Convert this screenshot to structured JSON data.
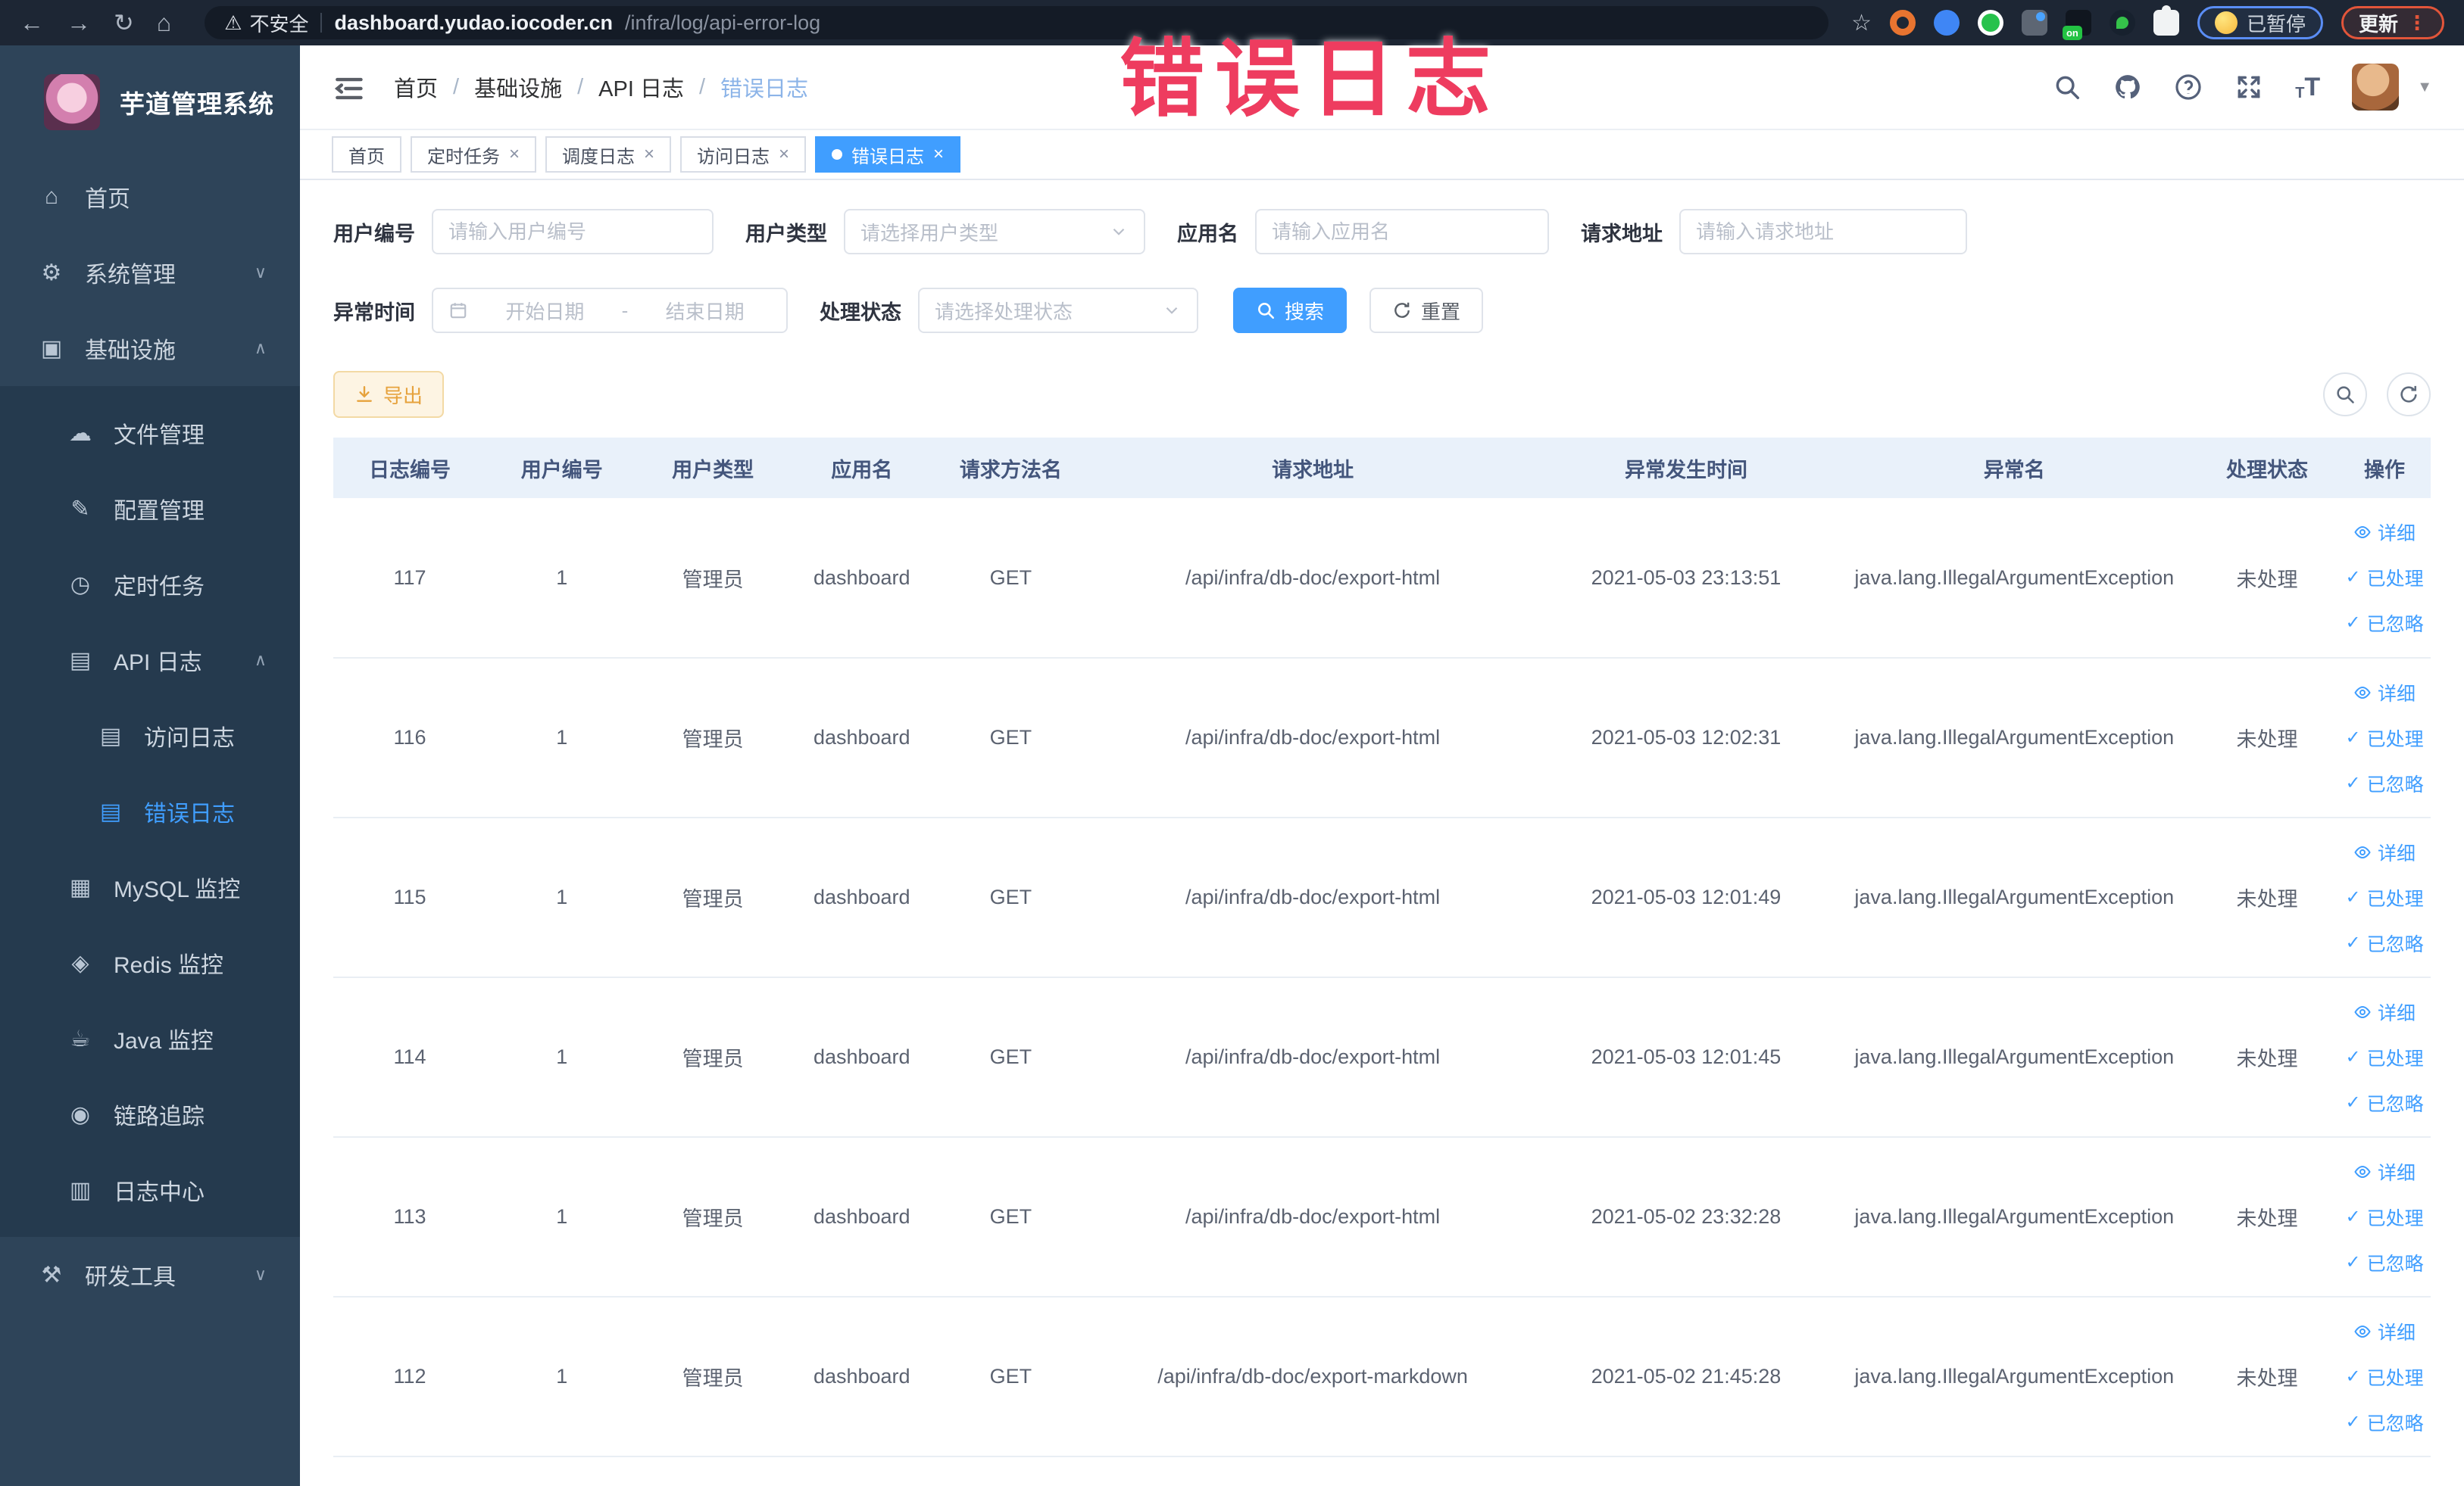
{
  "browser": {
    "security_label": "不安全",
    "url_domain": "dashboard.yudao.iocoder.cn",
    "url_path": "/infra/log/api-error-log",
    "paused_label": "已暂停",
    "update_label": "更新"
  },
  "sidebar": {
    "title": "芋道管理系统",
    "items": [
      {
        "label": "首页",
        "icon": "home",
        "level": 0
      },
      {
        "label": "系统管理",
        "icon": "gear",
        "level": 0,
        "chevron": "down"
      },
      {
        "label": "基础设施",
        "icon": "monitor",
        "level": 0,
        "chevron": "up"
      },
      {
        "label": "文件管理",
        "icon": "cloud",
        "level": 1,
        "sub": true
      },
      {
        "label": "配置管理",
        "icon": "edit",
        "level": 1,
        "sub": true
      },
      {
        "label": "定时任务",
        "icon": "timer",
        "level": 1,
        "sub": true
      },
      {
        "label": "API 日志",
        "icon": "log",
        "level": 1,
        "sub": true,
        "chevron": "up"
      },
      {
        "label": "访问日志",
        "icon": "log",
        "level": 2,
        "sub": true
      },
      {
        "label": "错误日志",
        "icon": "log",
        "level": 2,
        "sub": true,
        "active": true
      },
      {
        "label": "MySQL 监控",
        "icon": "mysql",
        "level": 1,
        "sub": true
      },
      {
        "label": "Redis 监控",
        "icon": "redis",
        "level": 1,
        "sub": true
      },
      {
        "label": "Java 监控",
        "icon": "java",
        "level": 1,
        "sub": true
      },
      {
        "label": "链路追踪",
        "icon": "trace",
        "level": 1,
        "sub": true
      },
      {
        "label": "日志中心",
        "icon": "logcenter",
        "level": 1,
        "sub": true
      },
      {
        "label": "研发工具",
        "icon": "tools",
        "level": 0,
        "chevron": "down"
      }
    ]
  },
  "header": {
    "breadcrumb": [
      "首页",
      "基础设施",
      "API 日志",
      "错误日志"
    ]
  },
  "watermark": "错误日志",
  "tabs": [
    {
      "label": "首页",
      "closable": false,
      "active": false
    },
    {
      "label": "定时任务",
      "closable": true,
      "active": false
    },
    {
      "label": "调度日志",
      "closable": true,
      "active": false
    },
    {
      "label": "访问日志",
      "closable": true,
      "active": false
    },
    {
      "label": "错误日志",
      "closable": true,
      "active": true
    }
  ],
  "filters": {
    "user_id": {
      "label": "用户编号",
      "placeholder": "请输入用户编号"
    },
    "user_type": {
      "label": "用户类型",
      "placeholder": "请选择用户类型"
    },
    "app_name": {
      "label": "应用名",
      "placeholder": "请输入应用名"
    },
    "request_url": {
      "label": "请求地址",
      "placeholder": "请输入请求地址"
    },
    "exception_time": {
      "label": "异常时间",
      "start": "开始日期",
      "separator": "-",
      "end": "结束日期"
    },
    "process_status": {
      "label": "处理状态",
      "placeholder": "请选择处理状态"
    },
    "search_label": "搜索",
    "reset_label": "重置"
  },
  "toolbar": {
    "export_label": "导出"
  },
  "table": {
    "columns": [
      "日志编号",
      "用户编号",
      "用户类型",
      "应用名",
      "请求方法名",
      "请求地址",
      "异常发生时间",
      "异常名",
      "处理状态",
      "操作"
    ],
    "action_labels": [
      "详细",
      "已处理",
      "已忽略"
    ],
    "rows": [
      {
        "id": "117",
        "user_id": "1",
        "user_type": "管理员",
        "app": "dashboard",
        "method": "GET",
        "url": "/api/infra/db-doc/export-html",
        "time": "2021-05-03 23:13:51",
        "exception": "java.lang.IllegalArgumentException",
        "status": "未处理"
      },
      {
        "id": "116",
        "user_id": "1",
        "user_type": "管理员",
        "app": "dashboard",
        "method": "GET",
        "url": "/api/infra/db-doc/export-html",
        "time": "2021-05-03 12:02:31",
        "exception": "java.lang.IllegalArgumentException",
        "status": "未处理"
      },
      {
        "id": "115",
        "user_id": "1",
        "user_type": "管理员",
        "app": "dashboard",
        "method": "GET",
        "url": "/api/infra/db-doc/export-html",
        "time": "2021-05-03 12:01:49",
        "exception": "java.lang.IllegalArgumentException",
        "status": "未处理"
      },
      {
        "id": "114",
        "user_id": "1",
        "user_type": "管理员",
        "app": "dashboard",
        "method": "GET",
        "url": "/api/infra/db-doc/export-html",
        "time": "2021-05-03 12:01:45",
        "exception": "java.lang.IllegalArgumentException",
        "status": "未处理"
      },
      {
        "id": "113",
        "user_id": "1",
        "user_type": "管理员",
        "app": "dashboard",
        "method": "GET",
        "url": "/api/infra/db-doc/export-html",
        "time": "2021-05-02 23:32:28",
        "exception": "java.lang.IllegalArgumentException",
        "status": "未处理"
      },
      {
        "id": "112",
        "user_id": "1",
        "user_type": "管理员",
        "app": "dashboard",
        "method": "GET",
        "url": "/api/infra/db-doc/export-markdown",
        "time": "2021-05-02 21:45:28",
        "exception": "java.lang.IllegalArgumentException",
        "status": "未处理"
      }
    ]
  },
  "colors": {
    "accent": "#409eff",
    "chrome_bg": "#1d2634",
    "sidebar_bg": "#2e4459",
    "submenu_bg": "#253a4e",
    "table_header_bg": "#e9f1fa",
    "warning_text": "#e6a23c",
    "warning_bg": "#fdf4e3",
    "warning_border": "#f3d9a4",
    "watermark": "#ee3c5f"
  }
}
